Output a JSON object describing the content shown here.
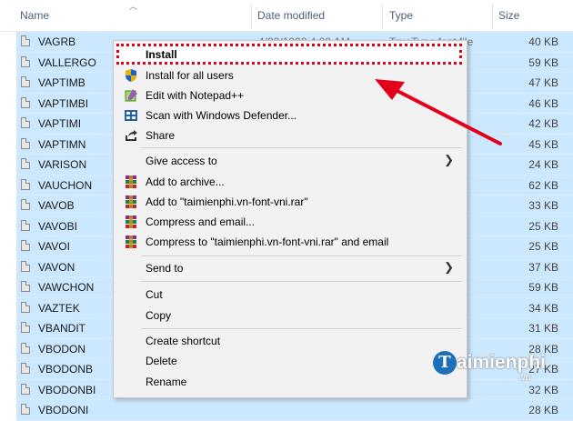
{
  "header": {
    "name": "Name",
    "date_modified": "Date modified",
    "type": "Type",
    "size": "Size"
  },
  "files": [
    {
      "name": "VAGRB",
      "size": "40 KB",
      "date": "4/23/1992 4:00 AM",
      "type": "TrueType font file"
    },
    {
      "name": "VALLERGO",
      "size": "59 KB"
    },
    {
      "name": "VAPTIMB",
      "size": "47 KB"
    },
    {
      "name": "VAPTIMBI",
      "size": "46 KB"
    },
    {
      "name": "VAPTIMI",
      "size": "42 KB"
    },
    {
      "name": "VAPTIMN",
      "size": "45 KB"
    },
    {
      "name": "VARISON",
      "size": "24 KB"
    },
    {
      "name": "VAUCHON",
      "size": "62 KB"
    },
    {
      "name": "VAVOB",
      "size": "33 KB"
    },
    {
      "name": "VAVOBI",
      "size": "25 KB"
    },
    {
      "name": "VAVOI",
      "size": "25 KB"
    },
    {
      "name": "VAVON",
      "size": "37 KB"
    },
    {
      "name": "VAWCHON",
      "size": "59 KB"
    },
    {
      "name": "VAZTEK",
      "size": "34 KB"
    },
    {
      "name": "VBANDIT",
      "size": "31 KB"
    },
    {
      "name": "VBODON",
      "size": "28 KB"
    },
    {
      "name": "VBODONB",
      "size": "27 KB"
    },
    {
      "name": "VBODONBI",
      "size": "32 KB"
    },
    {
      "name": "VBODONI",
      "size": "28 KB"
    }
  ],
  "menu": {
    "install": "Install",
    "install_all": "Install for all users",
    "notepad": "Edit with Notepad++",
    "defender": "Scan with Windows Defender...",
    "share": "Share",
    "give_access": "Give access to",
    "add_archive": "Add to archive...",
    "add_rar": "Add to \"taimienphi.vn-font-vni.rar\"",
    "compress_email": "Compress and email...",
    "compress_rar_email": "Compress to \"taimienphi.vn-font-vni.rar\" and email",
    "send_to": "Send to",
    "cut": "Cut",
    "copy": "Copy",
    "create_shortcut": "Create shortcut",
    "delete": "Delete",
    "rename": "Rename"
  },
  "watermark": {
    "logo_letter": "T",
    "text": "aimienphi",
    "suffix": ".vn"
  },
  "colors": {
    "selection": "#cce8ff",
    "highlight_border": "#e0001a",
    "arrow": "#e3001b",
    "watermark_blue": "#1d6fb8"
  }
}
